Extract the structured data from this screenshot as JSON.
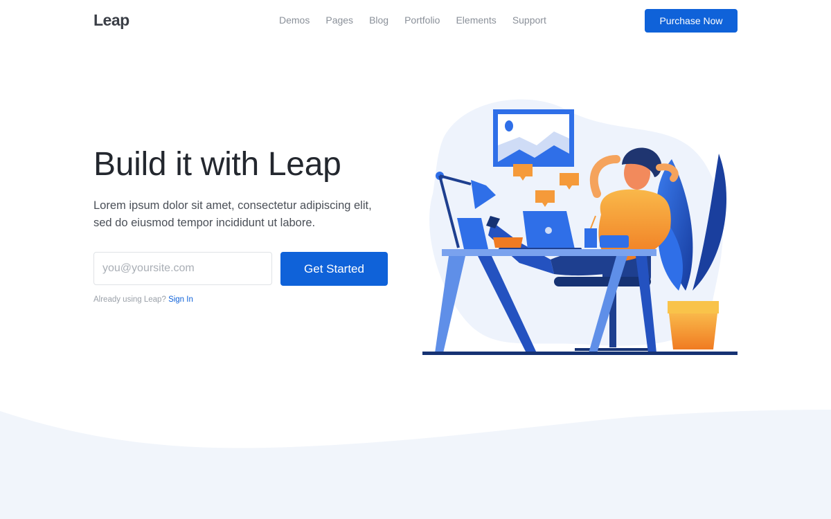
{
  "header": {
    "logo": "Leap",
    "nav": [
      "Demos",
      "Pages",
      "Blog",
      "Portfolio",
      "Elements",
      "Support"
    ],
    "cta_label": "Purchase Now"
  },
  "hero": {
    "title": "Build it with Leap",
    "text": "Lorem ipsum dolor sit amet, consectetur adipiscing elit, sed do eiusmod tempor incididunt ut labore.",
    "email_placeholder": "you@yoursite.com",
    "button_label": "Get Started",
    "already_text": "Already using Leap?",
    "signin_label": "Sign In"
  },
  "colors": {
    "accent": "#0f62d9",
    "section_bg": "#f1f5fb",
    "illustration_orange": "#f38a27"
  }
}
